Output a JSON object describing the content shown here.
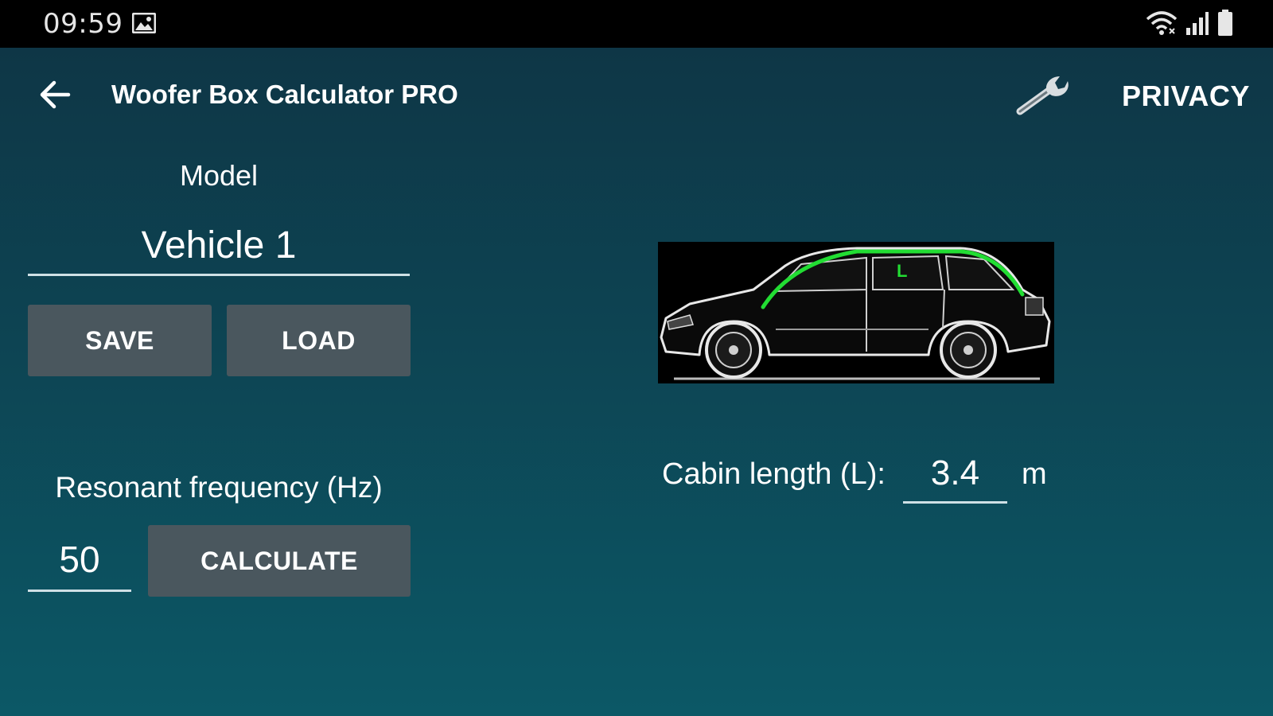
{
  "status_bar": {
    "time": "09:59",
    "icons": [
      "image-notification-icon",
      "wifi-icon",
      "signal-icon",
      "battery-icon"
    ]
  },
  "app_bar": {
    "title": "Woofer Box Calculator PRO",
    "privacy_label": "PRIVACY",
    "icons": [
      "back-arrow-icon",
      "wrench-icon"
    ]
  },
  "model": {
    "label": "Model",
    "value": "Vehicle 1",
    "save_label": "SAVE",
    "load_label": "LOAD"
  },
  "frequency": {
    "label": "Resonant frequency (Hz)",
    "value": "50",
    "calculate_label": "CALCULATE"
  },
  "cabin": {
    "label": "Cabin length (L):",
    "value": "3.4",
    "unit": "m",
    "diagram_marker": "L"
  },
  "colors": {
    "background_top": "#0e3444",
    "background_bottom": "#0c5866",
    "button": "#4a575e",
    "accent_green": "#22dd33",
    "status_bar": "#000000"
  }
}
